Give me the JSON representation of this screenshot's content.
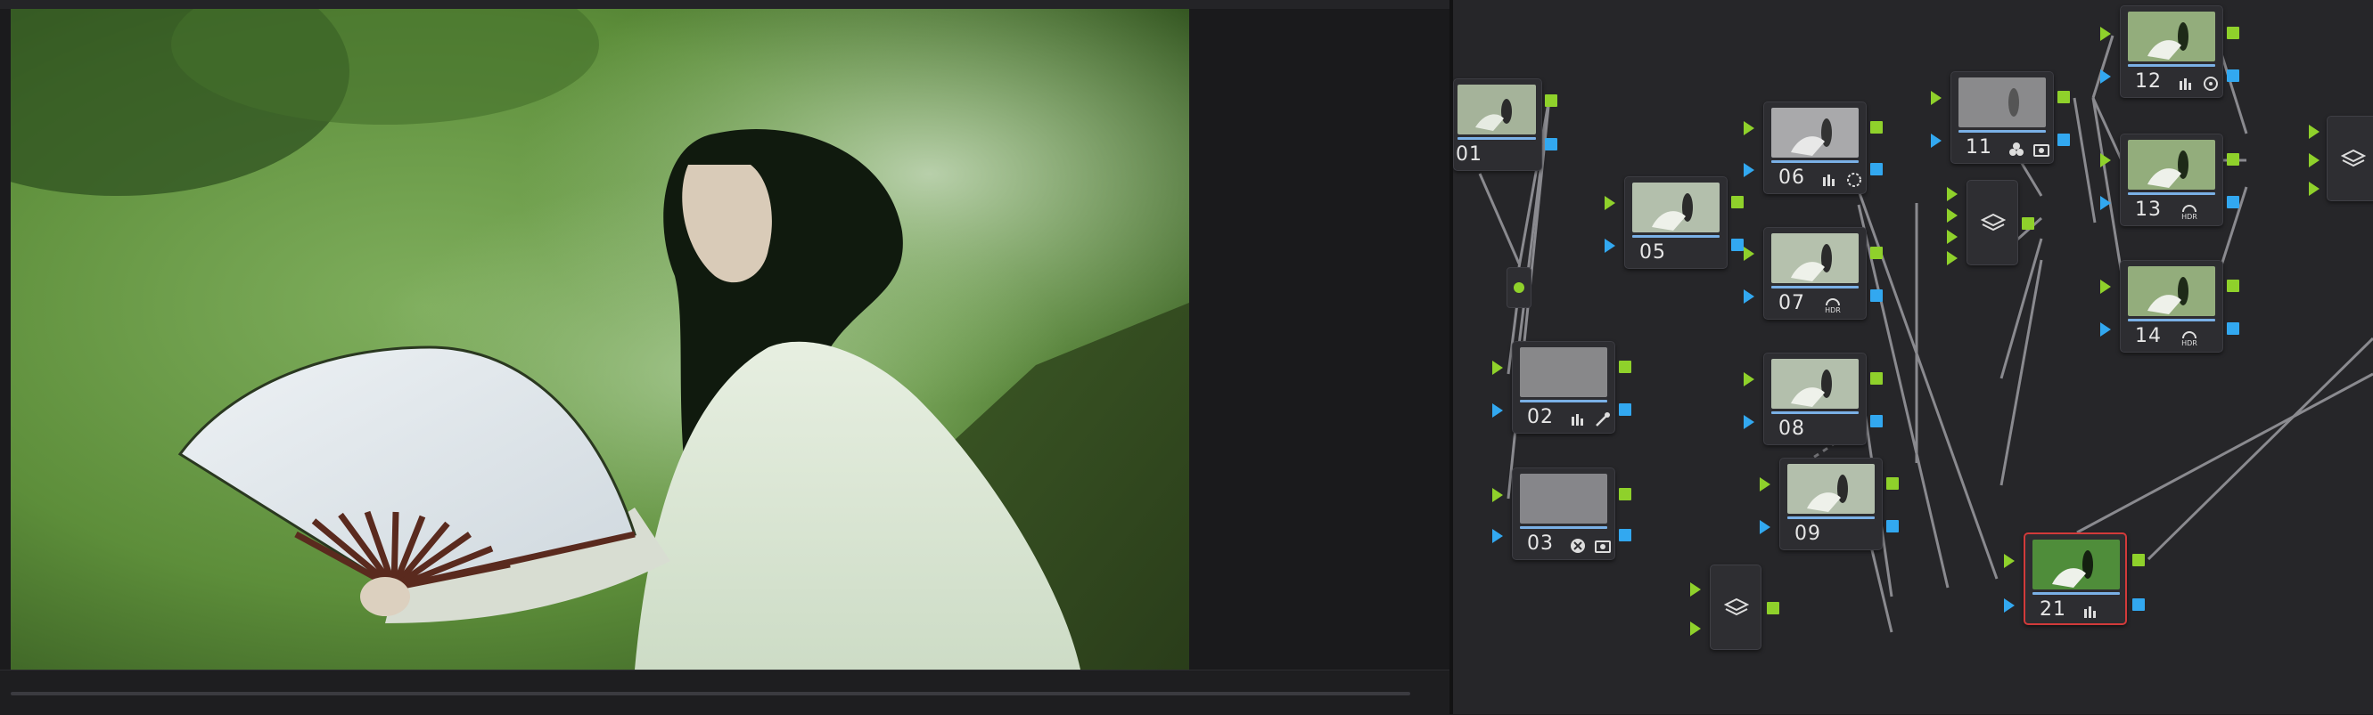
{
  "viewer": {
    "image_description_icon": "photo-frame"
  },
  "colors": {
    "accent_green": "#8fd12b",
    "accent_blue": "#32a8f0",
    "selection_red": "#d13a3a",
    "node_bar": "#7ab0e6"
  },
  "nodes": [
    {
      "id": "01",
      "label": "01",
      "icons": []
    },
    {
      "id": "02",
      "label": "02",
      "icons": [
        "curves-icon",
        "eyedropper-icon"
      ]
    },
    {
      "id": "03",
      "label": "03",
      "icons": [
        "color-warper-icon",
        "camera-raw-icon"
      ]
    },
    {
      "id": "05",
      "label": "05",
      "icons": []
    },
    {
      "id": "06",
      "label": "06",
      "icons": [
        "curves-icon",
        "power-window-icon"
      ]
    },
    {
      "id": "07",
      "label": "07",
      "icons": [
        "hdr-icon"
      ]
    },
    {
      "id": "08",
      "label": "08",
      "icons": []
    },
    {
      "id": "09",
      "label": "09",
      "icons": []
    },
    {
      "id": "11",
      "label": "11",
      "icons": [
        "qualifier-icon",
        "camera-raw-icon"
      ]
    },
    {
      "id": "12",
      "label": "12",
      "icons": [
        "curves-icon",
        "circle-window-icon"
      ]
    },
    {
      "id": "13",
      "label": "13",
      "icons": [
        "hdr-icon"
      ]
    },
    {
      "id": "14",
      "label": "14",
      "icons": [
        "hdr-icon"
      ]
    },
    {
      "id": "21",
      "label": "21",
      "icons": [
        "curves-icon"
      ]
    }
  ],
  "icon_text": {
    "hdr": "HDR"
  }
}
